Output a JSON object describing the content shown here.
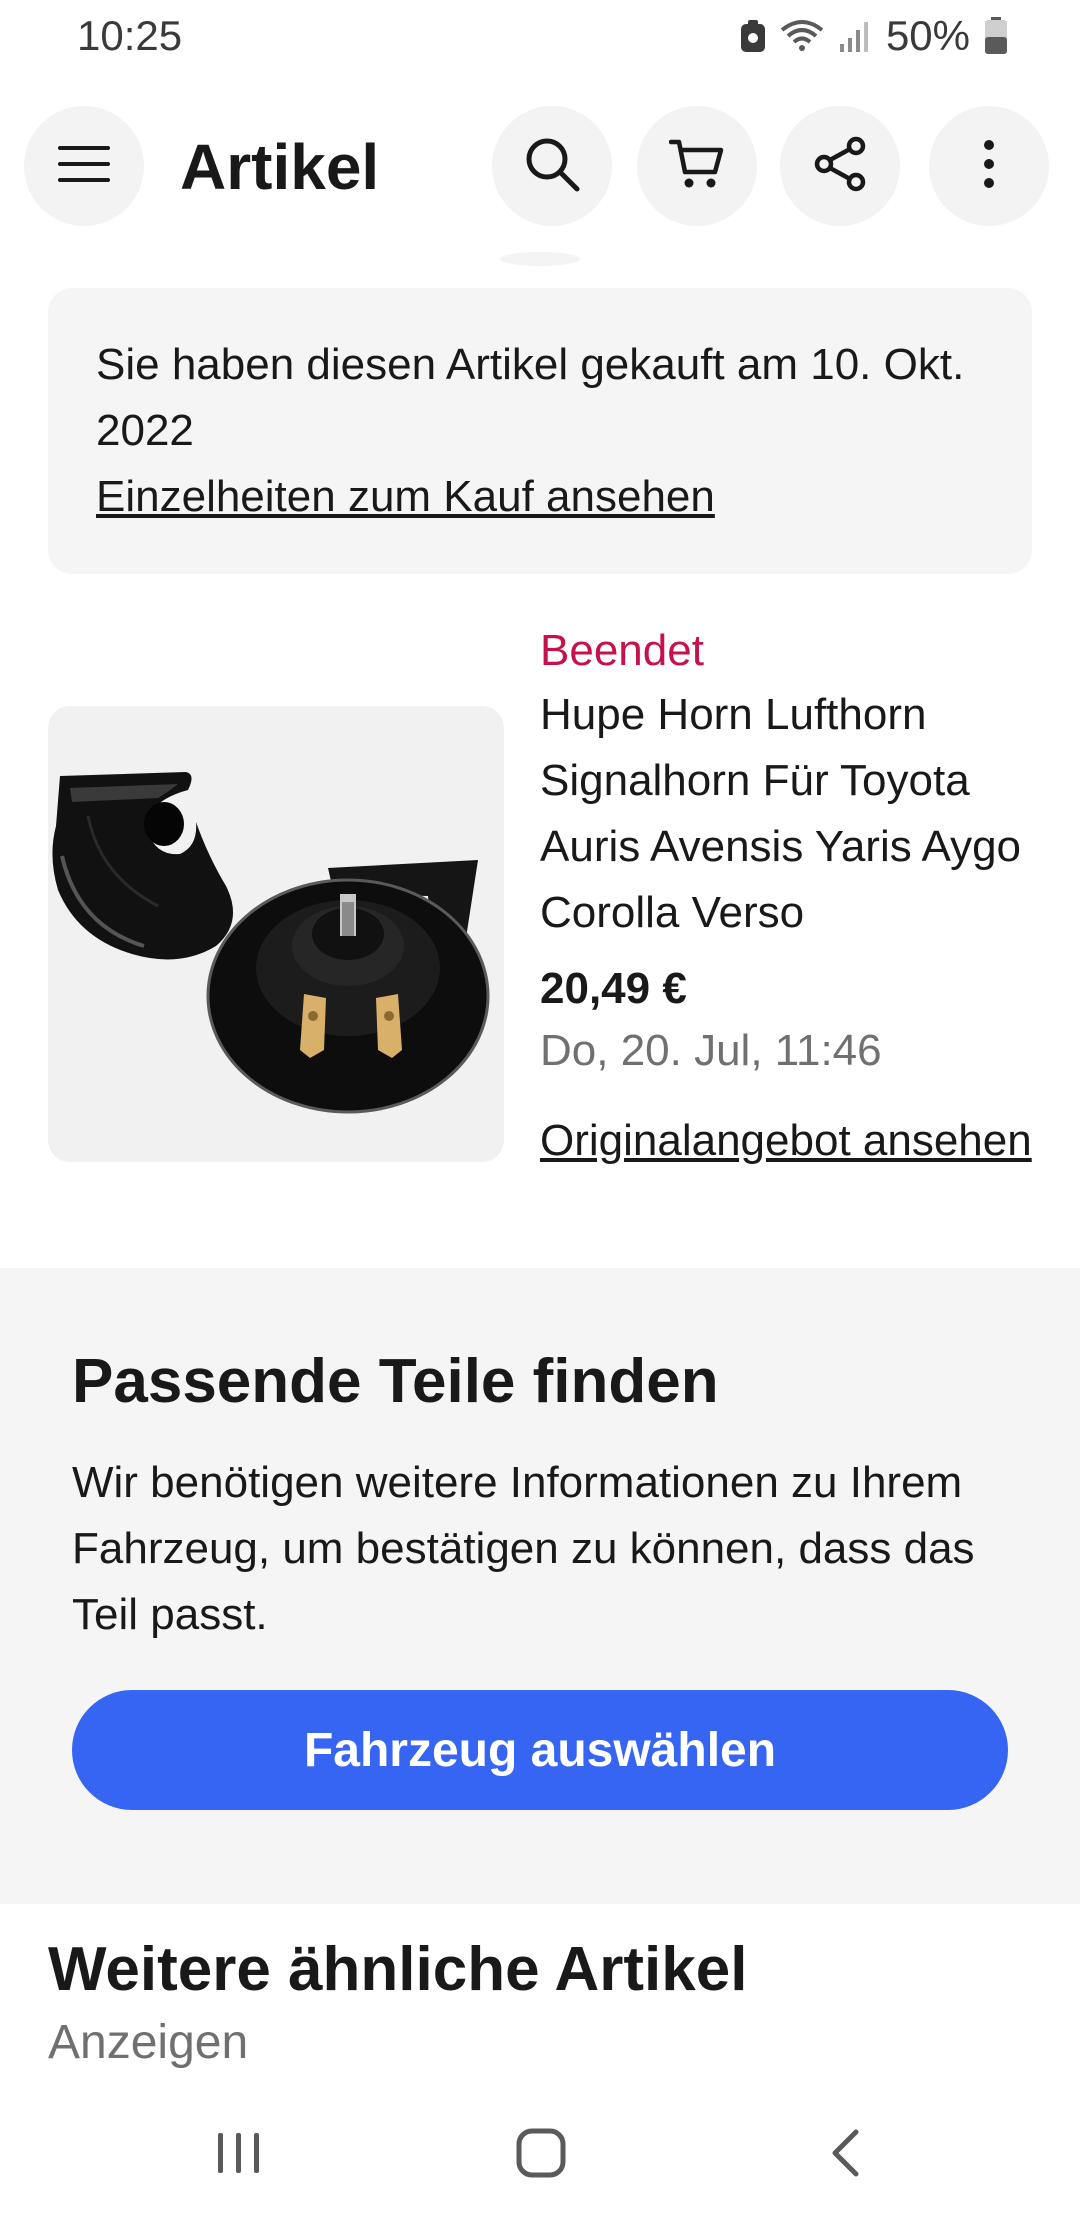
{
  "status_bar": {
    "time": "10:25",
    "battery": "50%",
    "icons": [
      "storage-icon",
      "wifi-icon",
      "signal-icon",
      "battery-icon"
    ]
  },
  "app_bar": {
    "title": "Artikel",
    "icons": [
      "menu-icon",
      "search-icon",
      "cart-icon",
      "share-icon",
      "more-icon"
    ]
  },
  "purchase_notice": {
    "text": "Sie haben diesen Artikel gekauft am 10. Okt. 2022",
    "link": "Einzelheiten zum Kauf ansehen"
  },
  "item": {
    "status": "Beendet",
    "title": "Hupe Horn Lufthorn Signalhorn Für Toyota Auris Avensis Yaris Aygo Corolla Verso",
    "price": "20,49 €",
    "date": "Do, 20. Jul, 11:46",
    "link": "Originalangebot ansehen"
  },
  "parts": {
    "title": "Passende Teile finden",
    "description": "Wir benötigen weitere Informationen zu Ihrem Fahrzeug, um bestätigen zu können, dass das Teil passt.",
    "button": "Fahrzeug auswählen"
  },
  "similar": {
    "title": "Weitere ähnliche Artikel",
    "subtitle": "Anzeigen"
  },
  "colors": {
    "accent": "#3665f3",
    "status_ended": "#c7114b",
    "card_background": "#f5f5f5"
  }
}
